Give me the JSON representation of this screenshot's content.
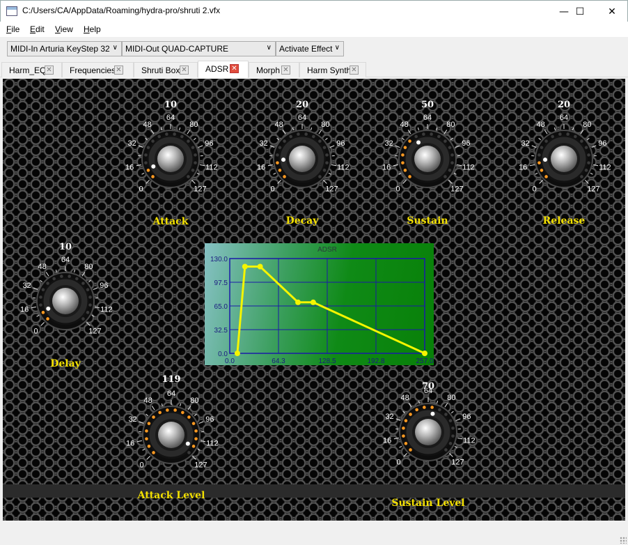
{
  "window": {
    "title": "C:/Users/CA/AppData/Roaming/hydra-pro/shruti 2.vfx",
    "minimize": "—",
    "maximize": "☐",
    "close": "✕"
  },
  "menu": [
    {
      "first": "F",
      "rest": "ile"
    },
    {
      "first": "E",
      "rest": "dit"
    },
    {
      "first": "V",
      "rest": "iew"
    },
    {
      "first": "H",
      "rest": "elp"
    }
  ],
  "toolbar": {
    "midi_in": "MIDI-In Arturia KeyStep 32",
    "midi_out": "MIDI-Out QUAD-CAPTURE",
    "effect": "Activate Effect",
    "arrow": "∨"
  },
  "tabs": [
    {
      "label": "Harm_EQ",
      "close": "✕",
      "active": false
    },
    {
      "label": "Frequencies",
      "close": "✕",
      "active": false
    },
    {
      "label": "Shruti Box",
      "close": "✕",
      "active": false
    },
    {
      "label": "ADSR",
      "close": "✕",
      "active": true
    },
    {
      "label": "Morph",
      "close": "✕",
      "active": false
    },
    {
      "label": "Harm Synth",
      "close": "✕",
      "active": false
    }
  ],
  "knobs": {
    "scale_labels": [
      "0",
      "16",
      "32",
      "48",
      "64",
      "80",
      "96",
      "112",
      "127"
    ],
    "max": 127,
    "accent": "#ff9a22",
    "items": [
      {
        "name": "Attack",
        "value": 10
      },
      {
        "name": "Decay",
        "value": 20
      },
      {
        "name": "Sustain",
        "value": 50
      },
      {
        "name": "Release",
        "value": 20
      },
      {
        "name": "Delay",
        "value": 10
      },
      {
        "name": "Attack Level",
        "value": 119
      },
      {
        "name": "Sustain Level",
        "value": 70
      }
    ]
  },
  "chart_data": {
    "type": "line",
    "title": "ADSR",
    "x": [
      10,
      20,
      40,
      90,
      110,
      257
    ],
    "y": [
      0,
      119,
      119,
      70,
      70,
      0
    ],
    "xlim": [
      0,
      257
    ],
    "ylim": [
      0,
      130
    ],
    "xticks": [
      "0.0",
      "64.3",
      "128.5",
      "192.8",
      "257.0"
    ],
    "yticks": [
      "0.0",
      "32.5",
      "65.0",
      "97.5",
      "130.0"
    ],
    "grid": true,
    "line_color": "#f5f500",
    "grid_color": "#1a1aa8"
  }
}
